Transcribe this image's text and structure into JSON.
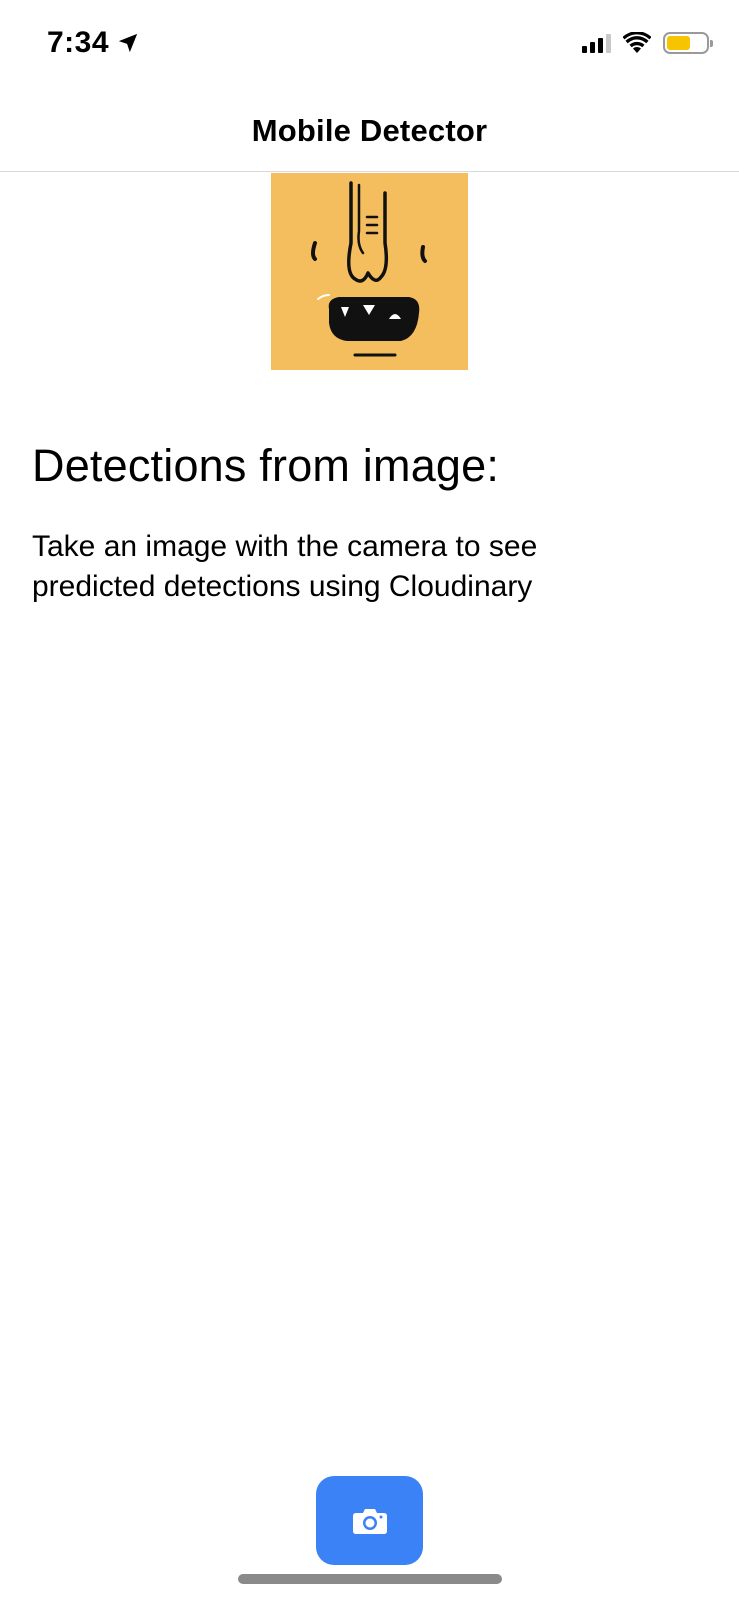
{
  "status_bar": {
    "time": "7:34",
    "location_icon": "location-arrow-icon",
    "signal_icon": "cellular-signal-icon",
    "wifi_icon": "wifi-icon",
    "battery_icon": "battery-icon",
    "battery_level": 0.6,
    "battery_color": "#f6c400"
  },
  "nav": {
    "title": "Mobile Detector"
  },
  "preview": {
    "background_color": "#f4bd5e"
  },
  "content": {
    "heading": "Detections from image:",
    "body": "Take an image with the camera to see predicted detections using Cloudinary"
  },
  "camera_button": {
    "icon": "camera-icon",
    "color": "#3b82f6"
  }
}
